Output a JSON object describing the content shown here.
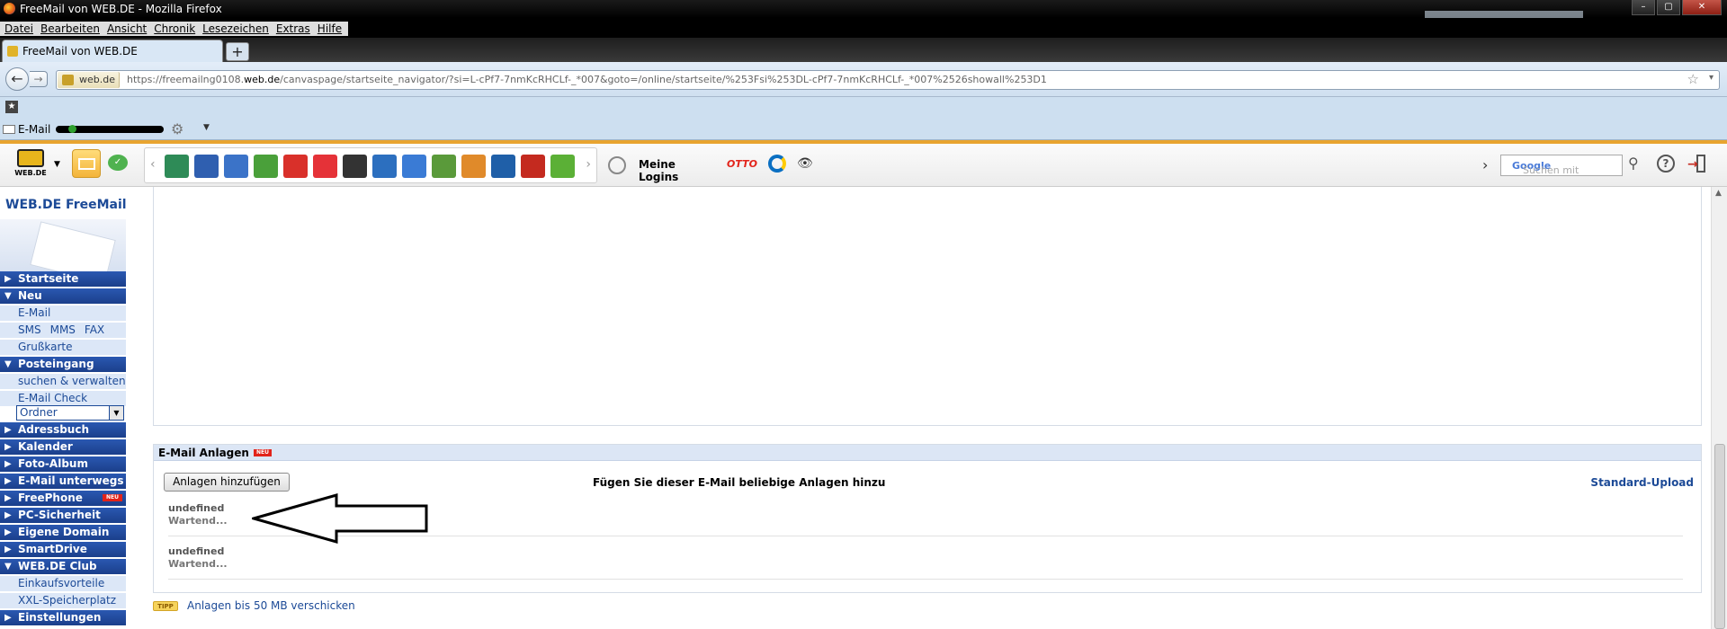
{
  "window": {
    "title": "FreeMail von WEB.DE - Mozilla Firefox",
    "controls": [
      "–",
      "▢",
      "✕"
    ]
  },
  "menubar": {
    "items": [
      "Datei",
      "Bearbeiten",
      "Ansicht",
      "Chronik",
      "Lesezeichen",
      "Extras",
      "Hilfe"
    ]
  },
  "tab": {
    "title": "FreeMail von WEB.DE",
    "new_tab": "+"
  },
  "navbar": {
    "site": "web.de",
    "url_prefix": "https://freemailng0108.",
    "url_domain": "web.de",
    "url_rest": "/canvaspage/startseite_navigator/?si=L-cPf7-7nmKcRHCLf-_*007&goto=/online/startseite/%253Fsi%253DL-cPf7-7nmKcRHCLf-_*007%2526showall%253D1"
  },
  "bookmarks": {
    "email_label": "E-Mail"
  },
  "toolbar": {
    "logo_text": "WEB.DE",
    "logins_label": "Meine Logins",
    "otto": "OTTO",
    "search_placeholder": "Suchen mit ",
    "search_brand": "Google",
    "help": "?",
    "apps": [
      {
        "icon": "notebook-icon",
        "color": "#2e8b57"
      },
      {
        "icon": "at-mail-icon",
        "color": "#2f5fb0"
      },
      {
        "icon": "rss-icon",
        "color": "#3b73c8"
      },
      {
        "icon": "bookmark-icon",
        "color": "#4aa03a"
      },
      {
        "icon": "pin-icon",
        "color": "#d9302a"
      },
      {
        "icon": "ebay-icon",
        "color": "#e53238"
      },
      {
        "icon": "de-icon",
        "color": "#333333"
      },
      {
        "icon": "messages-icon",
        "color": "#2c6fbf"
      },
      {
        "icon": "word-icon",
        "color": "#3a7bd5"
      },
      {
        "icon": "chart-icon",
        "color": "#5a9a3a"
      },
      {
        "icon": "documents-icon",
        "color": "#e08a2a"
      },
      {
        "icon": "news-icon",
        "color": "#1f5fa8"
      },
      {
        "icon": "video-icon",
        "color": "#c42a1f"
      },
      {
        "icon": "green-link-icon",
        "color": "#5bb036"
      }
    ]
  },
  "sidebar": {
    "title": "WEB.DE FreeMail",
    "startseite": "Startseite",
    "neu": "Neu",
    "email": "E-Mail",
    "sms": "SMS",
    "mms": "MMS",
    "fax": "FAX",
    "grusskarte": "Grußkarte",
    "posteingang": "Posteingang",
    "suchen": "suchen & verwalten",
    "email_check": "E-Mail Check",
    "ordner": "Ordner",
    "adressbuch": "Adressbuch",
    "kalender": "Kalender",
    "foto_album": "Foto-Album",
    "email_unterwegs": "E-Mail unterwegs",
    "freephone": "FreePhone",
    "pc_sicherheit": "PC-Sicherheit",
    "eigene_domain": "Eigene Domain",
    "smartdrive": "SmartDrive",
    "club": "WEB.DE Club",
    "einkaufsvorteile": "Einkaufsvorteile",
    "xxl": "XXL-Speicherplatz",
    "einstellungen": "Einstellungen",
    "neu_badge": "NEU"
  },
  "attachments": {
    "title": "E-Mail Anlagen",
    "neu_badge": "NEU",
    "add_button": "Anlagen hinzufügen",
    "hint": "Fügen Sie dieser E-Mail beliebige Anlagen hinzu",
    "standard_upload": "Standard-Upload",
    "items": [
      {
        "name": "undefined",
        "status": "Wartend..."
      },
      {
        "name": "undefined",
        "status": "Wartend..."
      }
    ]
  },
  "tip": {
    "badge": "TIPP",
    "link": "Anlagen bis 50 MB verschicken"
  }
}
